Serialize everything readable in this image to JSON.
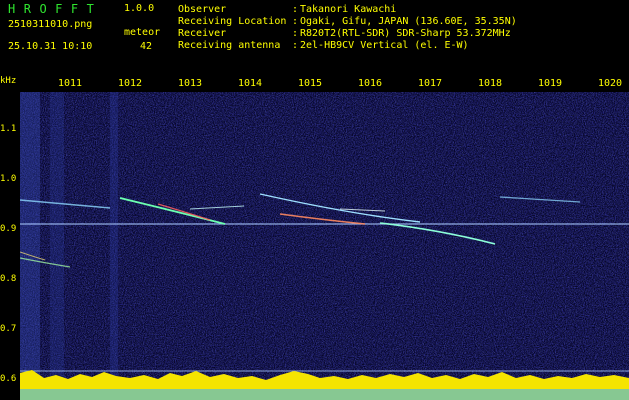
{
  "header": {
    "app_title": "HROFFT",
    "app_version": "1.0.0",
    "file_name": "2510311010.png",
    "date_time": "25.10.31 10:10",
    "meteor_label": "meteor",
    "meteor_count": "42",
    "info": [
      {
        "key": "Observer",
        "value": "Takanori Kawachi"
      },
      {
        "key": "Receiving Location",
        "value": "Ogaki, Gifu, JAPAN (136.60E, 35.35N)"
      },
      {
        "key": "Receiver",
        "value": "R820T2(RTL-SDR) SDR-Sharp 53.372MHz"
      },
      {
        "key": "Receiving antenna",
        "value": "2el-HB9CV Vertical (el. E-W)"
      }
    ]
  },
  "axes": {
    "y_unit": "kHz",
    "x_ticks": [
      "1011",
      "1012",
      "1013",
      "1014",
      "1015",
      "1016",
      "1017",
      "1018",
      "1019",
      "1020"
    ],
    "y_ticks": [
      "1.1",
      "1.0",
      "0.9",
      "0.8",
      "0.7",
      "0.6"
    ]
  },
  "colors": {
    "accent_green": "#2fe52f",
    "label_yellow": "#ffff00",
    "background": "#000000",
    "noise": "#0b0b48",
    "reference_line": "#a8c8ff"
  }
}
